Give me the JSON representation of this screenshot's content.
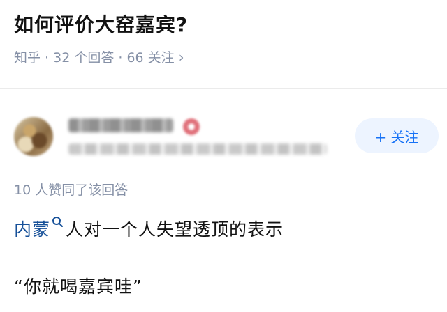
{
  "question": {
    "title": "如何评价大窑嘉宾?",
    "meta": "知乎 · 32 个回答 · 66 关注",
    "chevron_icon": "chevron-right-icon"
  },
  "author": {
    "follow_label": "+ 关注",
    "accent_color": "#1772f6",
    "follow_bg": "#edf4ff"
  },
  "answer": {
    "vote_info": "10 人赞同了该回答",
    "link_text": "内蒙",
    "link_icon": "search-icon",
    "line1_rest": "人对一个人失望透顶的表示",
    "quote": "“你就喝嘉宾哇”"
  }
}
